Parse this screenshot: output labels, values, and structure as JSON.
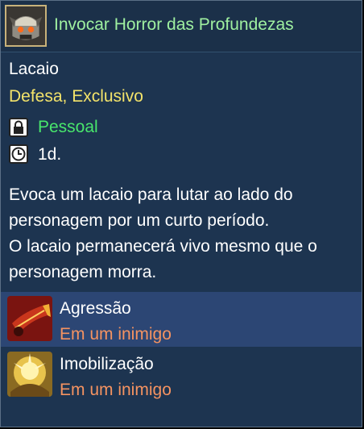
{
  "skill": {
    "title": "Invocar Horror das Profundezas",
    "icon": "stone-golem-icon",
    "type": "Lacaio",
    "tags": "Defesa, Exclusivo",
    "binding": "Pessoal",
    "duration": "1d."
  },
  "description": [
    "Evoca um lacaio para lutar ao lado do",
    "personagem por um curto período.",
    "O lacaio permanecerá vivo mesmo que o",
    "personagem morra."
  ],
  "effects": [
    {
      "name": "Agressão",
      "target": "Em um inimigo",
      "icon": "war-horn-icon",
      "selected": true
    },
    {
      "name": "Imobilização",
      "target": "Em um inimigo",
      "icon": "golden-burst-icon",
      "selected": false
    }
  ],
  "colors": {
    "panel": "#1d3450",
    "title": "#9ff0a0",
    "tags": "#f3e36a",
    "binding": "#48e66c",
    "target": "#f59361",
    "selected_row": "#2c4674"
  }
}
